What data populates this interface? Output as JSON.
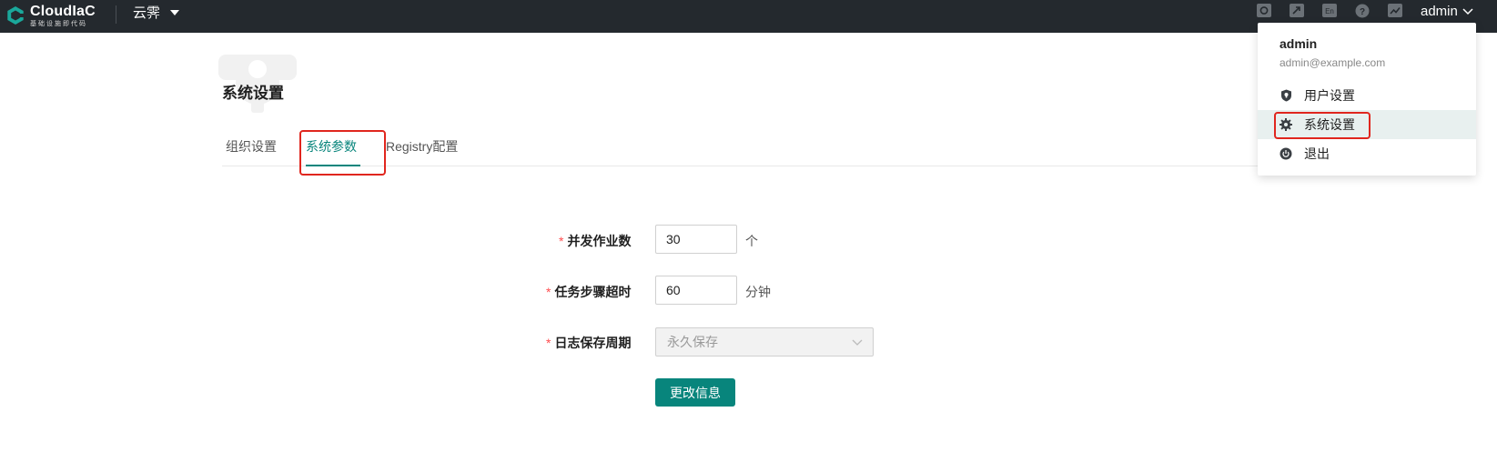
{
  "app": {
    "logo_name": "CloudIaC",
    "logo_sub": "基础设施即代码",
    "org_name": "云霁",
    "user": "admin"
  },
  "header_icons": [
    "dashboard-icon",
    "docs-icon",
    "language-en-icon",
    "help-icon",
    "monitor-icon"
  ],
  "header_icon_texts": {
    "language": "En",
    "help": "?"
  },
  "page": {
    "title": "系统设置"
  },
  "tabs": [
    {
      "label": "组织设置",
      "active": false
    },
    {
      "label": "系统参数",
      "active": true
    },
    {
      "label": "Registry配置",
      "active": false
    }
  ],
  "form": {
    "concurrency": {
      "label": "并发作业数",
      "value": "30",
      "unit": "个"
    },
    "step_timeout": {
      "label": "任务步骤超时",
      "value": "60",
      "unit": "分钟"
    },
    "log_retention": {
      "label": "日志保存周期",
      "value": "永久保存"
    },
    "submit_label": "更改信息",
    "required_mark": "*"
  },
  "dropdown": {
    "name": "admin",
    "email": "admin@example.com",
    "items": [
      {
        "label": "用户设置",
        "icon": "user-shield-icon"
      },
      {
        "label": "系统设置",
        "icon": "gear-icon",
        "selected": true
      },
      {
        "label": "退出",
        "icon": "power-icon"
      }
    ]
  },
  "colors": {
    "accent": "#08857c",
    "topbar": "#24292e",
    "highlight": "#e0261e",
    "required": "#ff4d4f"
  }
}
